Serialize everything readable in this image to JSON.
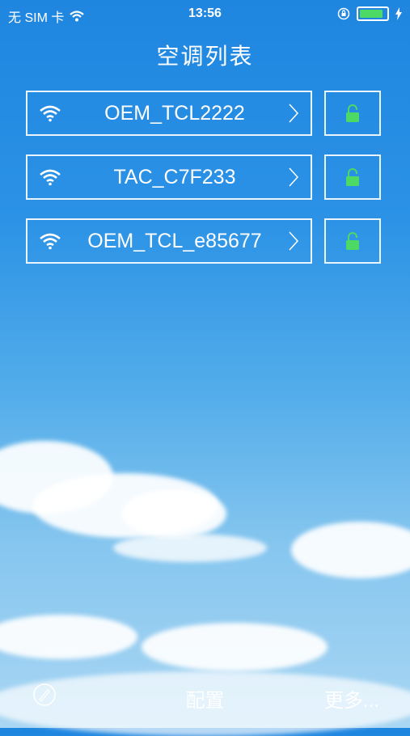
{
  "status_bar": {
    "carrier": "无 SIM 卡",
    "time": "13:56"
  },
  "header": {
    "title": "空调列表"
  },
  "ac_list": [
    {
      "name": "OEM_TCL2222"
    },
    {
      "name": "TAC_C7F233"
    },
    {
      "name": "OEM_TCL_e85677"
    }
  ],
  "icons": {
    "wifi": "wifi-icon",
    "chevron": "chevron-right-icon",
    "lock": "lock-icon",
    "compass": "compass-icon"
  },
  "colors": {
    "lock": "#4cd964",
    "battery": "#4cd964"
  },
  "bottom_bar": {
    "config_label": "配置",
    "more_label": "更多..."
  }
}
